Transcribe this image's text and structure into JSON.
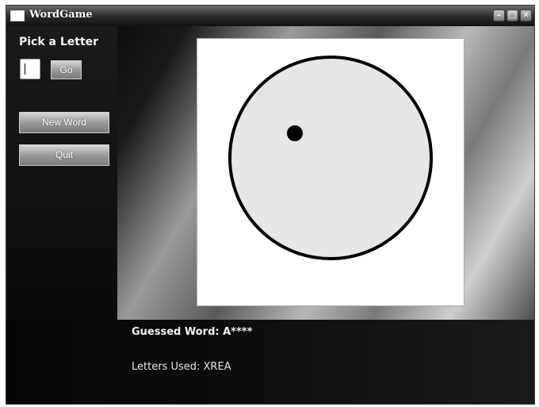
{
  "window": {
    "title": "WordGame",
    "controls": {
      "minimize": "–",
      "maximize": "□",
      "close": "✕"
    }
  },
  "sidebar": {
    "pick_label": "Pick a Letter",
    "letter_input": {
      "value": "",
      "placeholder": ""
    },
    "go_label": "Go",
    "new_word_label": "New Word",
    "quit_label": "Quit"
  },
  "drawing": {
    "shapes": [
      "head-circle",
      "eye-dot"
    ],
    "colors": {
      "head_fill": "#e6e6e6",
      "outline": "#000000",
      "canvas_bg": "#ffffff"
    }
  },
  "status": {
    "guessed_word": "Guessed Word: A****",
    "letters_used": "Letters Used: XREA"
  }
}
